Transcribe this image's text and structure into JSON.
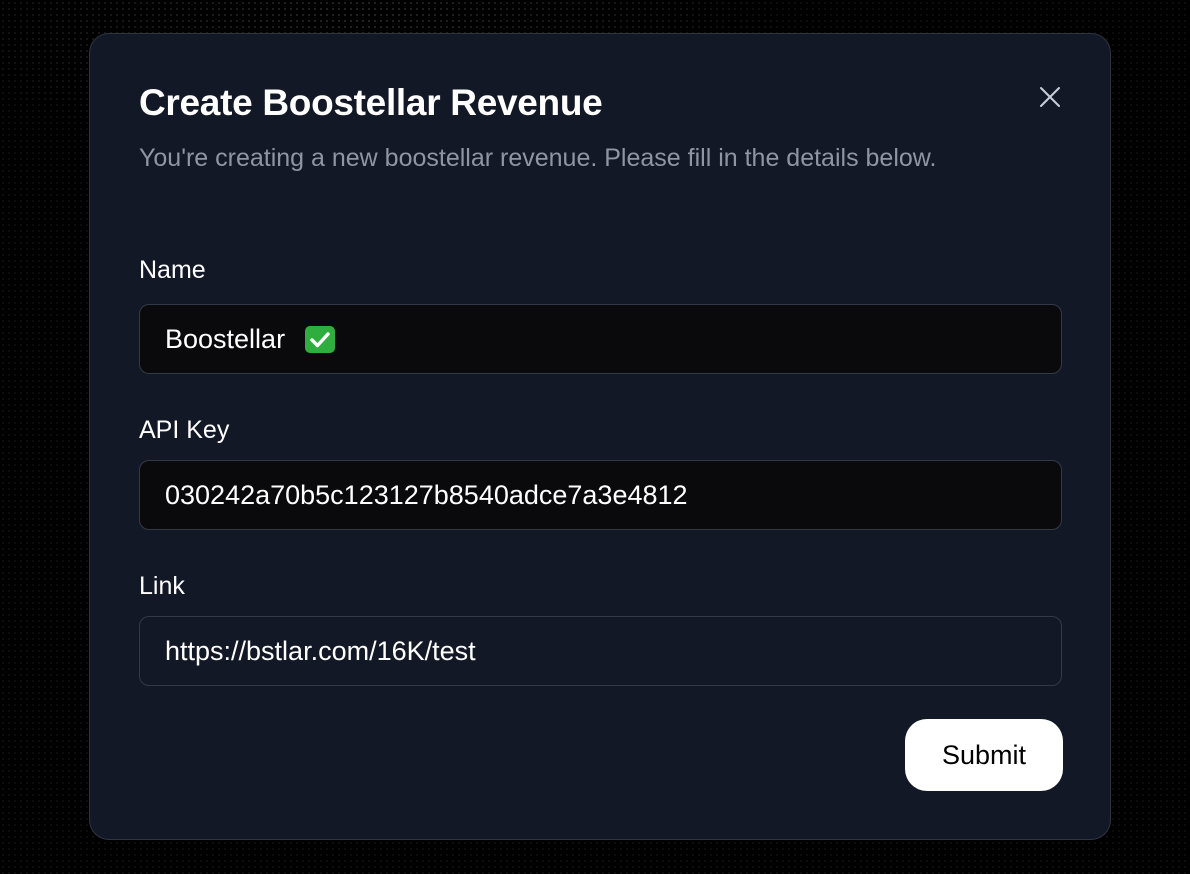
{
  "dialog": {
    "title": "Create Boostellar Revenue",
    "subtitle": "You're creating a new boostellar revenue. Please fill in the details below.",
    "close_icon": "close-icon"
  },
  "form": {
    "name": {
      "label": "Name",
      "value": "Boostellar",
      "emoji_icon": "check-mark-emoji-icon"
    },
    "api_key": {
      "label": "API Key",
      "value": "030242a70b5c123127b8540adce7a3e4812"
    },
    "link": {
      "label": "Link",
      "value": "https://bstlar.com/16K/test"
    },
    "submit_label": "Submit"
  },
  "colors": {
    "dialog_background": "#121826",
    "dialog_border": "#2e3442",
    "input_background": "#0a0a0c",
    "subtitle_text": "#8e95a3",
    "submit_background": "#ffffff",
    "check_emoji": "#2fae3f"
  }
}
